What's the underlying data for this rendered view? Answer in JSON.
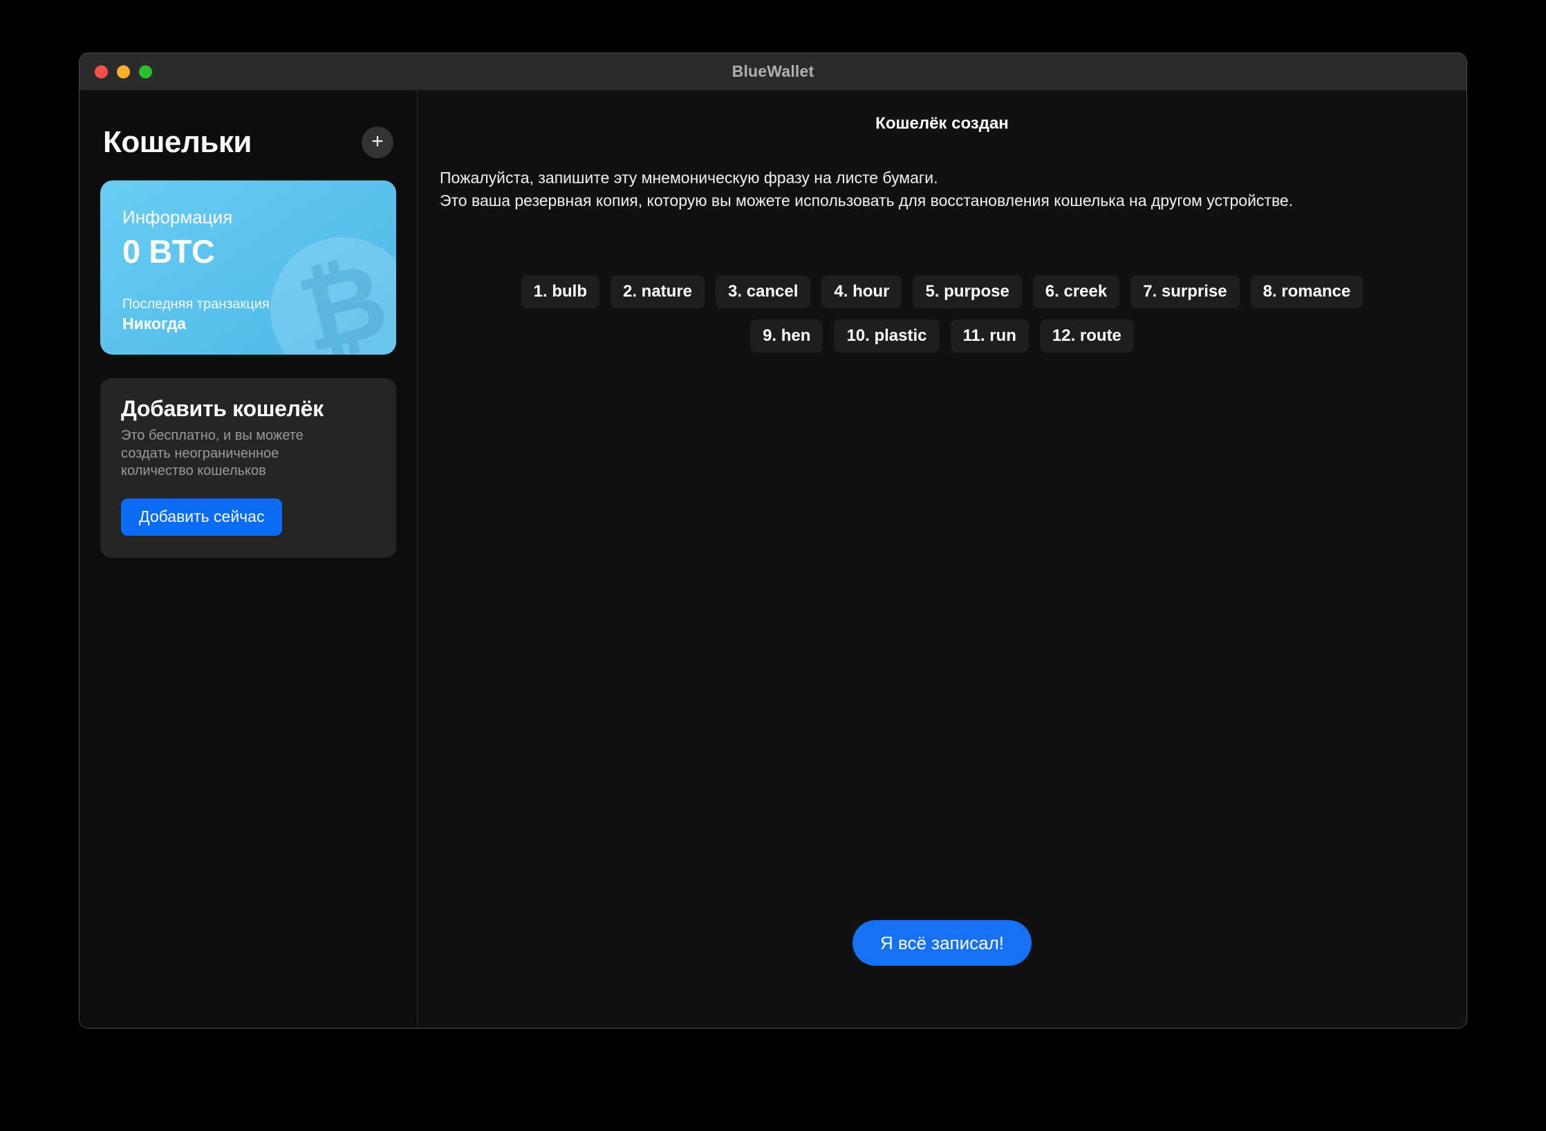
{
  "window": {
    "title": "BlueWallet",
    "traffic_lights": [
      {
        "name": "close",
        "color": "#f8514a"
      },
      {
        "name": "minimize",
        "color": "#fab12a"
      },
      {
        "name": "zoom",
        "color": "#2bbf2e"
      }
    ]
  },
  "sidebar": {
    "title": "Кошельки",
    "add_icon": "+",
    "wallet_card": {
      "label": "Информация",
      "balance": "0 BTC",
      "last_tx_label": "Последняя транзакция",
      "last_tx_value": "Никогда",
      "watermark_icon": "bitcoin-icon",
      "watermark_glyph": "₿",
      "accent": "#5cc3ee"
    },
    "add_wallet": {
      "title": "Добавить кошелёк",
      "description": "Это бесплатно, и вы можете создать неограниченное количество кошельков",
      "button_label": "Добавить сейчас",
      "button_color": "#0a6cf5"
    }
  },
  "main": {
    "title": "Кошелёк создан",
    "description_line_1": "Пожалуйста, запишите эту мнемоническую фразу на листе бумаги.",
    "description_line_2": "Это ваша резервная копия, которую вы можете использовать для восстановления кошелька на другом устройстве.",
    "mnemonic": [
      "1. bulb",
      "2. nature",
      "3. cancel",
      "4. hour",
      "5. purpose",
      "6. creek",
      "7. surprise",
      "8. romance",
      "9. hen",
      "10. plastic",
      "11. run",
      "12. route"
    ],
    "confirm_label": "Я всё записал!",
    "confirm_color": "#1771f3"
  }
}
